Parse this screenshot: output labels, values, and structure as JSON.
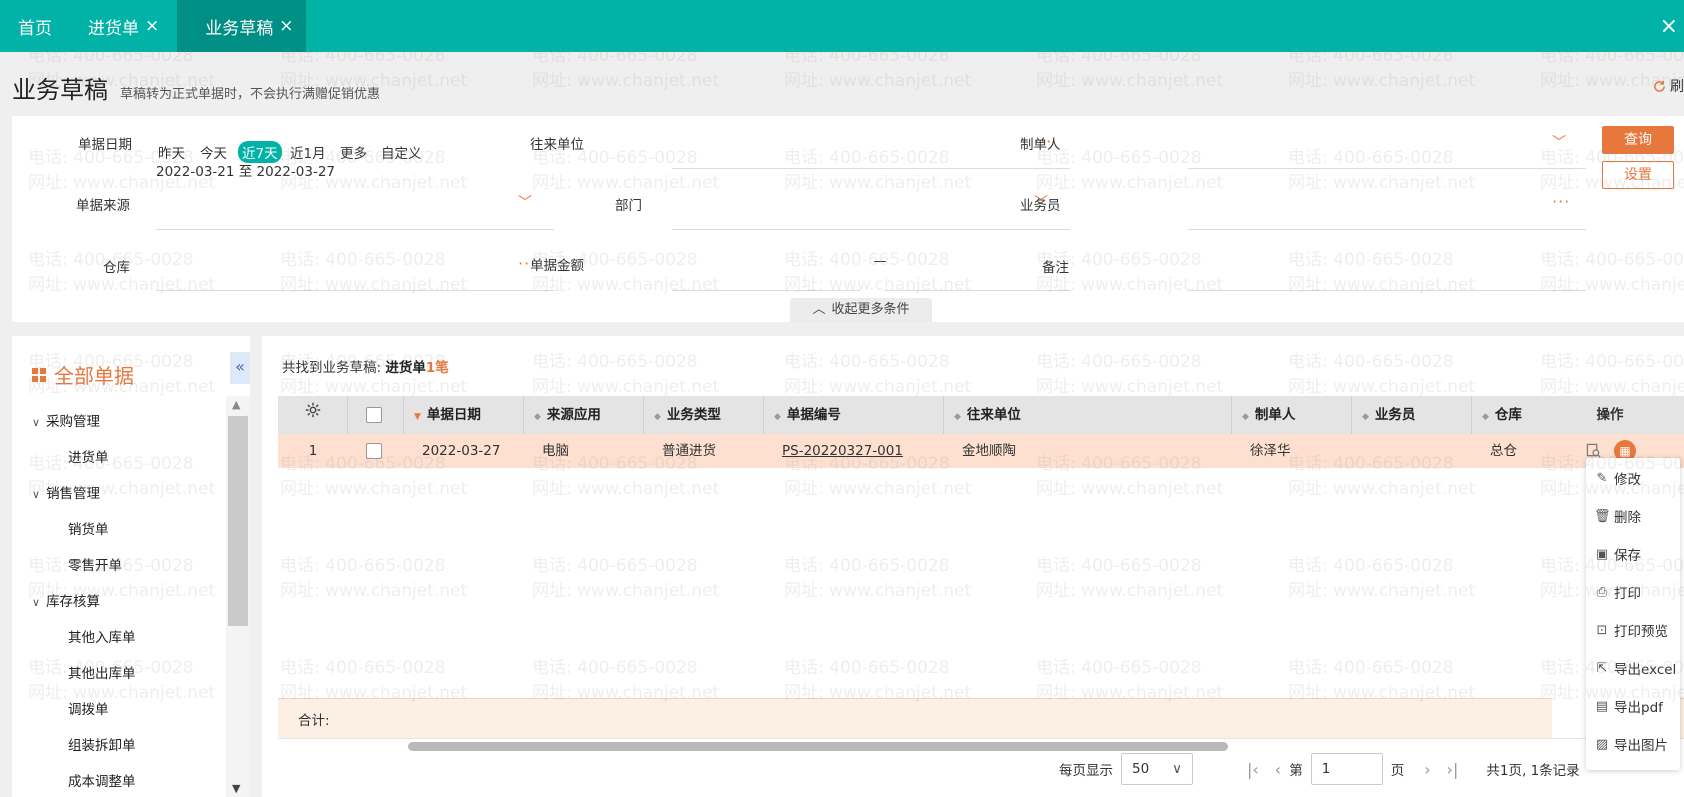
{
  "tabs": [
    {
      "label": "首页",
      "closable": false
    },
    {
      "label": "进货单",
      "closable": true
    },
    {
      "label": "业务草稿",
      "closable": true,
      "active": true
    }
  ],
  "close_glyph": "×",
  "page": {
    "title": "业务草稿",
    "subtitle": "草稿转为正式单据时，不会执行满赠促销优惠",
    "refresh_label": "刷"
  },
  "filters": {
    "date_label": "单据日期",
    "date_options": [
      "昨天",
      "今天",
      "近7天",
      "近1月",
      "更多",
      "自定义"
    ],
    "date_selected": "近7天",
    "date_range": "2022-03-21 至 2022-03-27",
    "partner_label": "往来单位",
    "creator_label": "制单人",
    "source_label": "单据来源",
    "dept_label": "部门",
    "salesman_label": "业务员",
    "warehouse_label": "仓库",
    "amount_label": "单据金额",
    "amount_sep": "—",
    "remark_label": "备注",
    "query_button": "查询",
    "setting_button": "设置",
    "collapse_label": "收起更多条件"
  },
  "sidebar": {
    "title": "全部单据",
    "groups": [
      {
        "label": "采购管理",
        "items": [
          "进货单"
        ]
      },
      {
        "label": "销售管理",
        "items": [
          "销货单",
          "零售开单"
        ]
      },
      {
        "label": "库存核算",
        "items": [
          "其他入库单",
          "其他出库单",
          "调拨单",
          "组装拆卸单",
          "成本调整单"
        ]
      }
    ]
  },
  "result": {
    "prefix": "共找到业务草稿: ",
    "type": "进货单",
    "count": "1笔"
  },
  "table": {
    "columns": [
      "单据日期",
      "来源应用",
      "业务类型",
      "单据编号",
      "往来单位",
      "制单人",
      "业务员",
      "仓库"
    ],
    "op_header": "操作",
    "rows": [
      {
        "index": "1",
        "date": "2022-03-27",
        "source": "电脑",
        "biz_type": "普通进货",
        "doc_no": "PS-20220327-001",
        "partner": "金地顺陶",
        "creator": "徐泽华",
        "salesman": "",
        "warehouse": "总仓"
      }
    ],
    "total_label": "合计:"
  },
  "menu": {
    "items": [
      {
        "label": "修改",
        "icon": "edit-icon"
      },
      {
        "label": "删除",
        "icon": "trash-icon"
      },
      {
        "label": "保存",
        "icon": "save-icon"
      },
      {
        "label": "打印",
        "icon": "print-icon"
      },
      {
        "label": "打印预览",
        "icon": "print-preview-icon"
      },
      {
        "label": "导出excel",
        "icon": "export-excel-icon"
      },
      {
        "label": "导出pdf",
        "icon": "export-pdf-icon"
      },
      {
        "label": "导出图片",
        "icon": "export-image-icon"
      }
    ]
  },
  "pager": {
    "per_page_label": "每页显示",
    "per_page": "50",
    "page_prefix": "第",
    "page_value": "1",
    "page_suffix": "页",
    "summary": "共1页, 1条记录"
  },
  "watermark": {
    "phone": "电话: 400-665-0028",
    "site": "网址: www.chanjet.net"
  },
  "colors": {
    "teal": "#00b3a6",
    "accent": "#e8773c",
    "row_highlight": "#fde0d0"
  }
}
